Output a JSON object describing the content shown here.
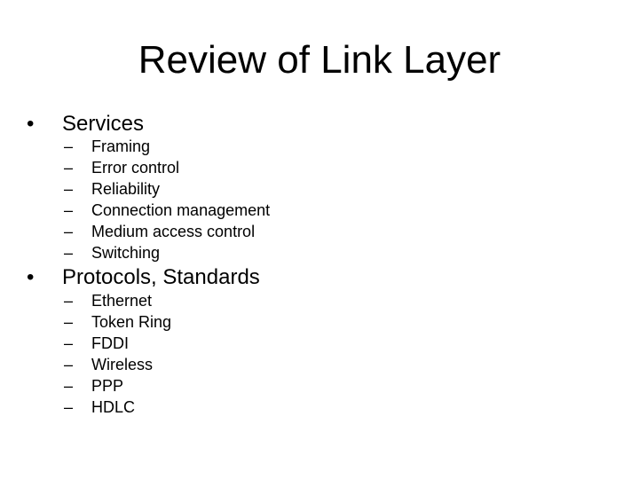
{
  "slide": {
    "title": "Review of Link Layer",
    "sections": [
      {
        "heading": "Services",
        "bullet": "•",
        "items": [
          "Framing",
          "Error control",
          "Reliability",
          "Connection management",
          "Medium access control",
          "Switching"
        ]
      },
      {
        "heading": "Protocols, Standards",
        "bullet": "•",
        "items": [
          "Ethernet",
          "Token Ring",
          "FDDI",
          "Wireless",
          "PPP",
          "HDLC"
        ]
      }
    ],
    "sub_bullet": "–"
  }
}
